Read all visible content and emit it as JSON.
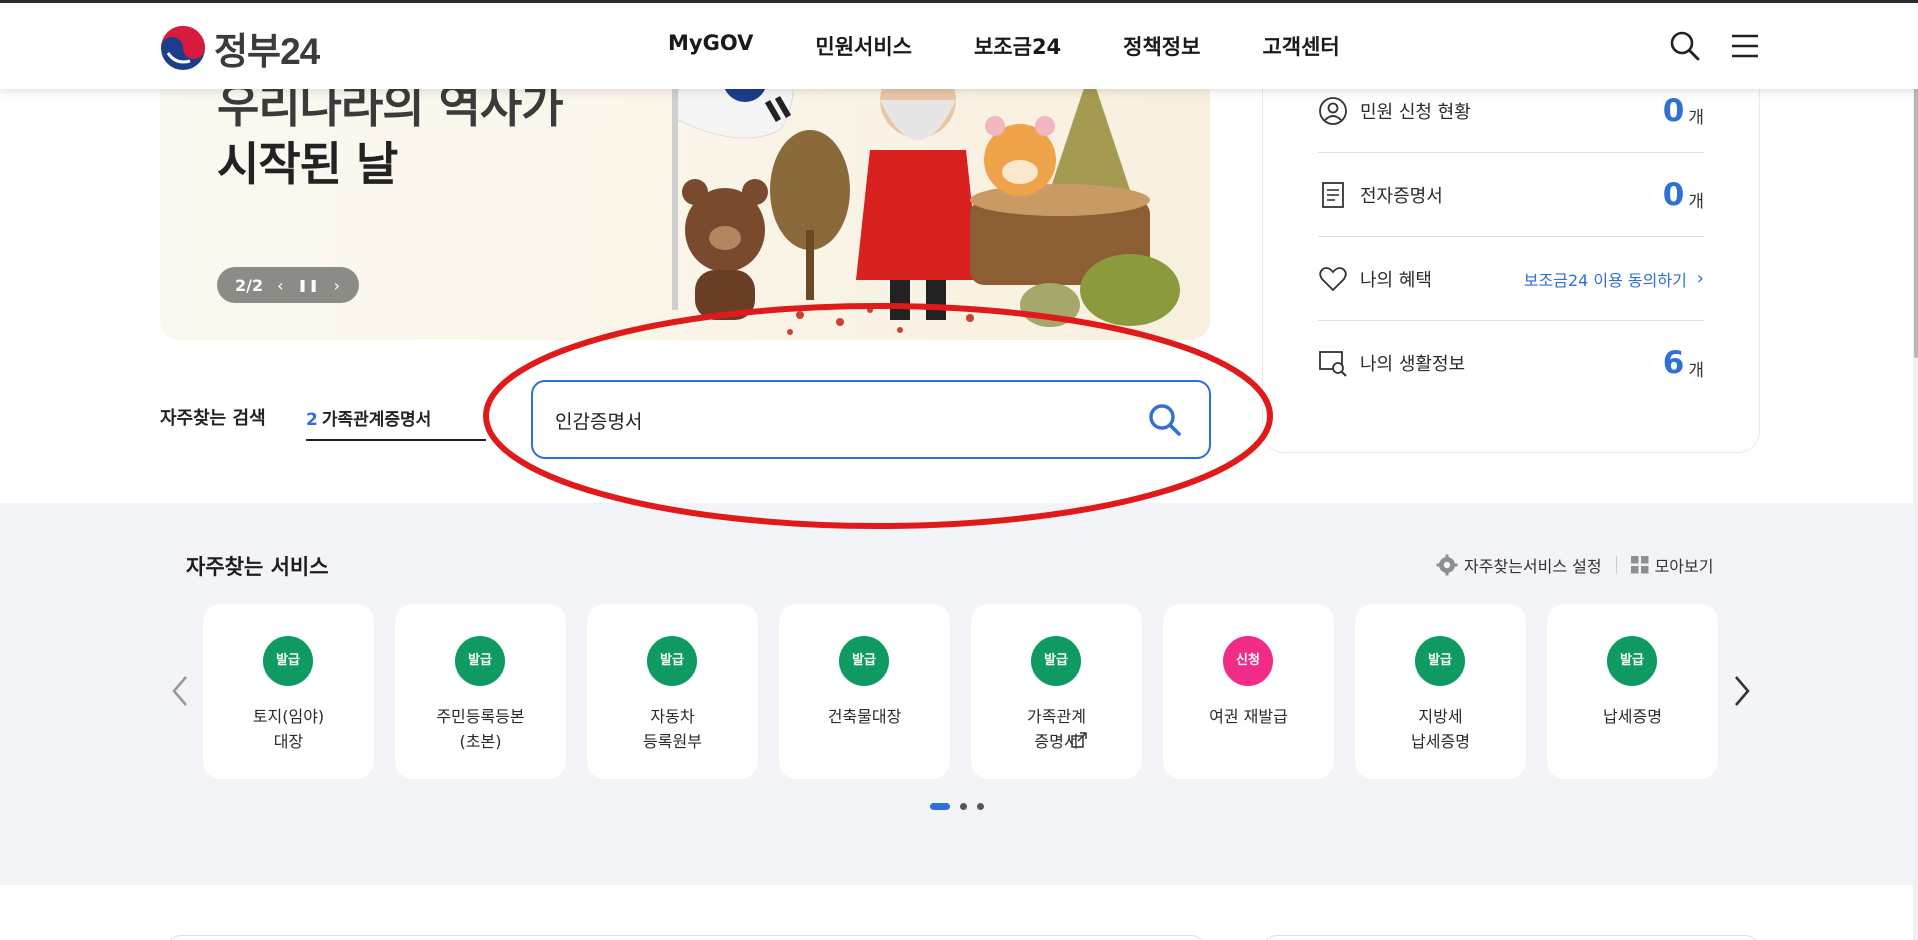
{
  "header": {
    "logo_text": "정부24",
    "nav": [
      "MyGOV",
      "민원서비스",
      "보조금24",
      "정책정보",
      "고객센터"
    ]
  },
  "banner": {
    "line1": "우리나라의 역사가",
    "line2": "시작된 날",
    "counter": "2/2"
  },
  "status": {
    "rows": [
      {
        "label": "민원 신청 현황",
        "value": "0",
        "unit": "개"
      },
      {
        "label": "전자증명서",
        "value": "0",
        "unit": "개"
      },
      {
        "label": "나의 혜택",
        "link": "보조금24 이용 동의하기"
      },
      {
        "label": "나의 생활정보",
        "value": "6",
        "unit": "개"
      }
    ]
  },
  "popular_search": {
    "label": "자주찾는 검색",
    "rank": "2",
    "keyword": "가족관계증명서"
  },
  "search": {
    "value": "인감증명서"
  },
  "services": {
    "title": "자주찾는 서비스",
    "settings_label": "자주찾는서비스 설정",
    "view_all_label": "모아보기",
    "cards": [
      {
        "badge": "발급",
        "label": "토지(임야)\n대장"
      },
      {
        "badge": "발급",
        "label": "주민등록등본\n(초본)"
      },
      {
        "badge": "발급",
        "label": "자동차\n등록원부"
      },
      {
        "badge": "발급",
        "label": "건축물대장"
      },
      {
        "badge": "발급",
        "label": "가족관계\n증명서"
      },
      {
        "badge": "신청",
        "label": "여권 재발급"
      },
      {
        "badge": "발급",
        "label": "지방세\n납세증명"
      },
      {
        "badge": "발급",
        "label": "납세증명"
      }
    ]
  },
  "colors": {
    "accent": "#2f6fd6",
    "badge_green": "#0e9a61",
    "badge_pink": "#f12c86",
    "annotation": "#e01a1a"
  }
}
